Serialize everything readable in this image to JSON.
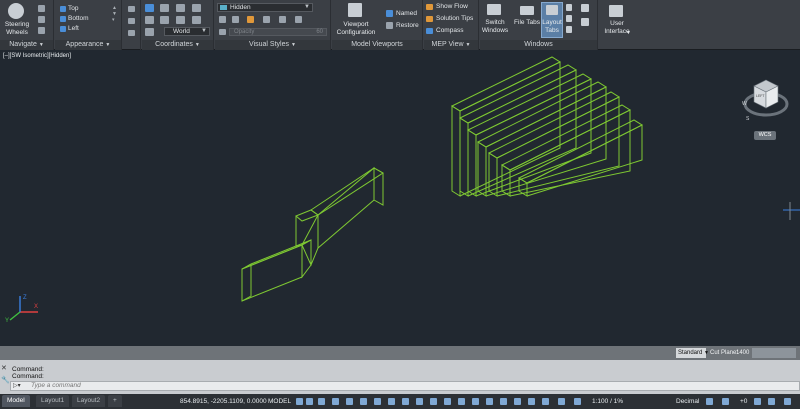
{
  "ribbon": {
    "navigate": {
      "title": "Navigate",
      "steering_wheels": "Steering Wheels"
    },
    "appearance": {
      "title": "Appearance",
      "views": [
        "Top",
        "Bottom",
        "Left"
      ]
    },
    "coordinates": {
      "title": "Coordinates",
      "ucs": "World"
    },
    "visual_styles": {
      "title": "Visual Styles",
      "style": "Hidden",
      "slider_text": "Opacity",
      "slider_value": "60"
    },
    "model_viewports": {
      "title": "Model Viewports",
      "viewport_config": "Viewport Configuration",
      "named": "Named",
      "restore": "Restore"
    },
    "mep_view": {
      "title": "MEP View",
      "show_flow": "Show Flow",
      "solution_tips": "Solution Tips",
      "compass": "Compass"
    },
    "windows": {
      "title": "Windows",
      "switch_windows": "Switch Windows",
      "file_tabs": "File Tabs",
      "layout_tabs": "Layout Tabs"
    },
    "user_interface": {
      "label": "User Interface"
    }
  },
  "viewport": {
    "label": "[–][SW Isometric][Hidden]",
    "wcs": "WCS",
    "viewcube_face": "LEFT"
  },
  "mini_status": {
    "scale_label": "Standard",
    "cut_plane": "Cut Plane:",
    "cut_value": "1400"
  },
  "command": {
    "history": [
      "Command:",
      "Command:"
    ],
    "placeholder": "Type a command"
  },
  "tabs": [
    "Model",
    "Layout1",
    "Layout2",
    "+"
  ],
  "status": {
    "coords": "854.8915, -2205.1109, 0.0000",
    "model": "MODEL",
    "scale": "1:100 / 1%",
    "units": "Decimal",
    "elevation": "+0"
  },
  "colors": {
    "background": "#212830",
    "geometry": "#7ec832",
    "ribbon": "#3b3f45"
  }
}
